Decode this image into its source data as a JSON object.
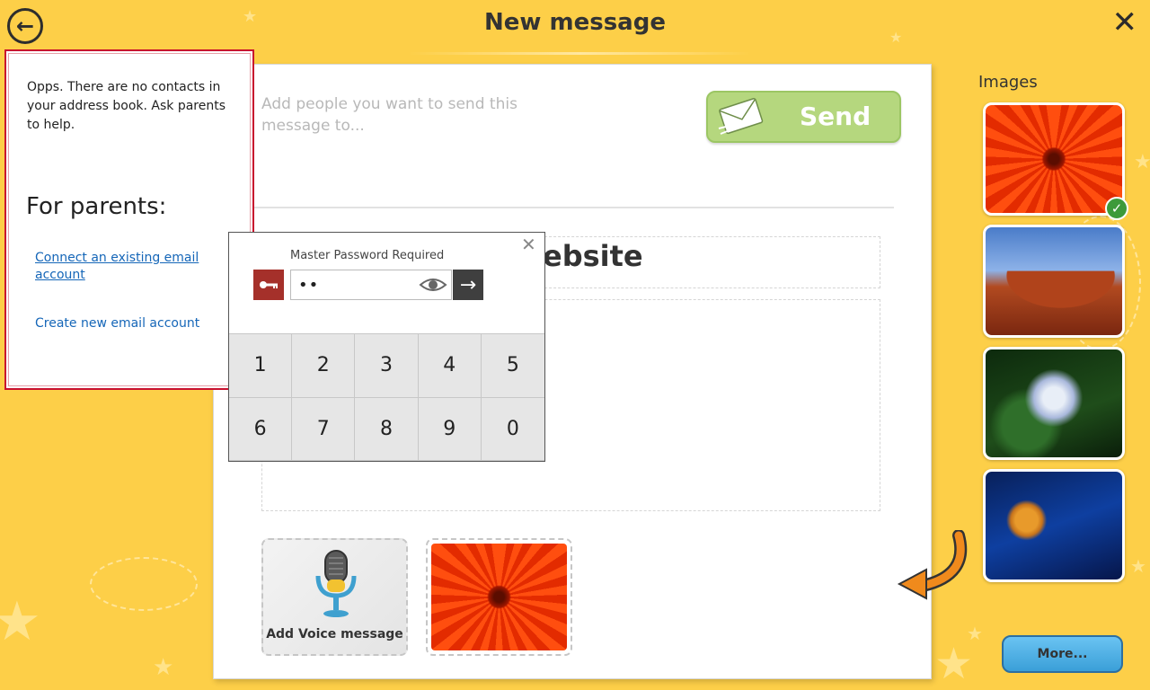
{
  "title_bar": {
    "title": "New message",
    "back_icon": "back-arrow-icon",
    "close_icon": "close-icon"
  },
  "composer": {
    "to_placeholder": "Add people you want to send this message to...",
    "send_label": "Send",
    "send_icon": "envelope-icon",
    "subject_visible_text": "ebsite",
    "voice_label": "Add Voice message",
    "voice_icon": "microphone-icon"
  },
  "images_panel": {
    "heading": "Images",
    "selected_icon": "checkmark-icon",
    "more_label": "More..."
  },
  "contacts_panel": {
    "message": "Opps. There are no contacts in your address book. Ask parents to help.",
    "parents_heading": "For parents:",
    "link_connect": "Connect an existing email account",
    "link_create": "Create new email account"
  },
  "password_popup": {
    "title": "Master Password Required",
    "value": "••",
    "key_icon": "key-icon",
    "eye_icon": "eye-icon",
    "go_icon": "arrow-right-icon",
    "close_icon": "close-icon",
    "keys": [
      "1",
      "2",
      "3",
      "4",
      "5",
      "6",
      "7",
      "8",
      "9",
      "0"
    ]
  },
  "colors": {
    "background": "#fdcf48",
    "send_green": "#b5d77e",
    "more_blue": "#3a9fd8",
    "panel_border_red": "#c8102e",
    "key_red": "#a5302a",
    "link_blue": "#1566b8"
  }
}
